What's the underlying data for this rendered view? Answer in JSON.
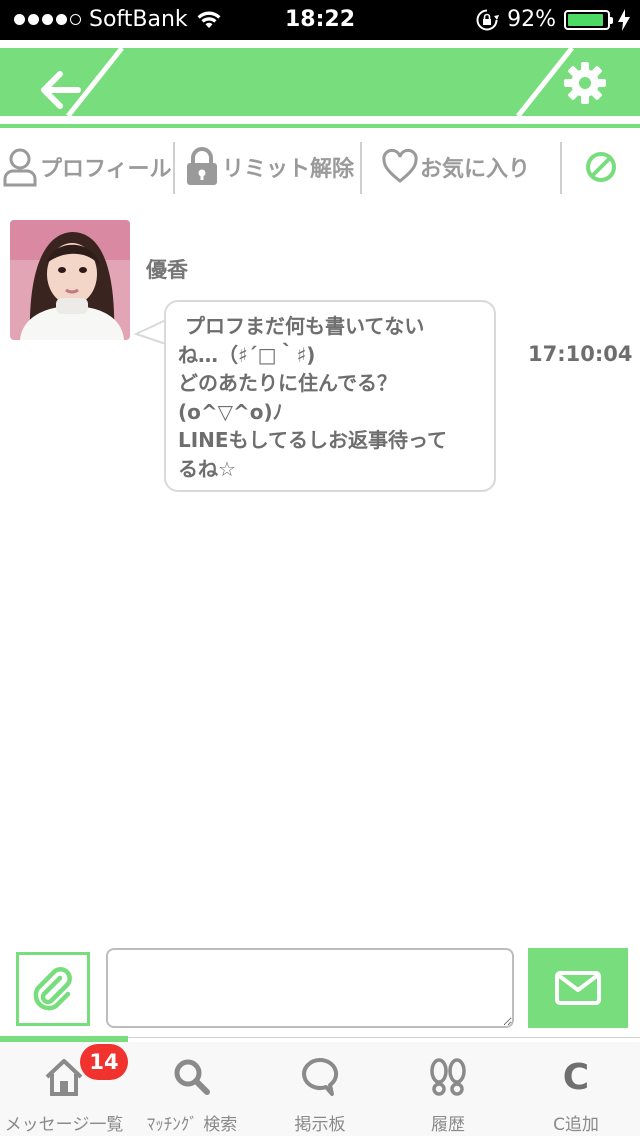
{
  "status_bar": {
    "carrier": "SoftBank",
    "time": "18:22",
    "battery": "92%",
    "battery_level": 0.92,
    "signal_bars": 4
  },
  "header": {
    "back_icon": "arrow-left-icon",
    "settings_icon": "gear-icon"
  },
  "tabs": {
    "profile": "プロフィール",
    "limit_release": "リミット解除",
    "favorite": "お気に入り",
    "block_icon": "block-icon"
  },
  "message": {
    "sender": "優香",
    "lines": [
      " プロフまだ何も書いてない",
      "ね…（♯´□｀♯)",
      "どのあたりに住んでる？",
      "(o^▽^o)ﾉ",
      "LINEもしてるしお返事待って",
      "るね☆"
    ],
    "time": "17:10:04"
  },
  "input": {
    "value": "",
    "placeholder": ""
  },
  "bottom_nav": {
    "items": [
      {
        "label": "メッセージ一覧",
        "icon": "home-icon",
        "badge": "14"
      },
      {
        "label": "ﾏｯﾁﾝｸﾞ 検索",
        "icon": "search-icon"
      },
      {
        "label": "掲示板",
        "icon": "chat-bubble-icon"
      },
      {
        "label": "履歴",
        "icon": "footprints-icon"
      },
      {
        "label": "C追加",
        "icon": "c-letter-icon",
        "glyph": "C"
      }
    ]
  },
  "colors": {
    "accent": "#77dd7d",
    "badge": "#f0332e",
    "text_gray": "#9a9a9a"
  }
}
